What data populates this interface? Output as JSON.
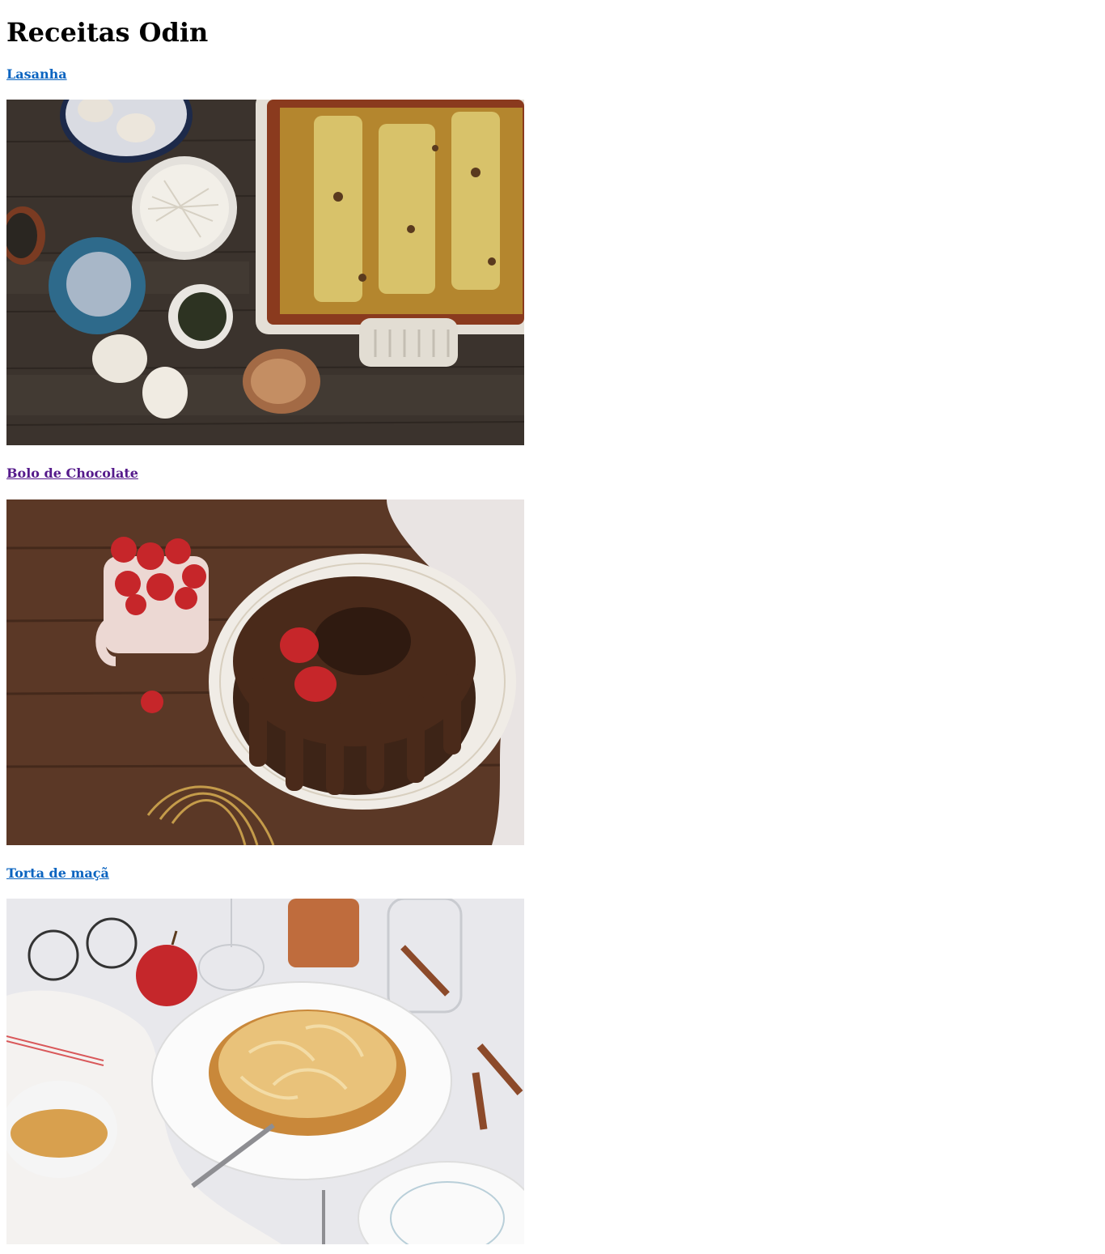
{
  "page": {
    "title": "Receitas Odin"
  },
  "recipes": [
    {
      "label": "Lasanha",
      "visited": false,
      "image": "lasagna-photo"
    },
    {
      "label": "Bolo de Chocolate",
      "visited": true,
      "image": "chocolate-cake-photo"
    },
    {
      "label": "Torta de maçã",
      "visited": false,
      "image": "apple-pie-photo"
    }
  ],
  "colors": {
    "link_unvisited": "#0b64c0",
    "link_visited": "#551a8b"
  }
}
